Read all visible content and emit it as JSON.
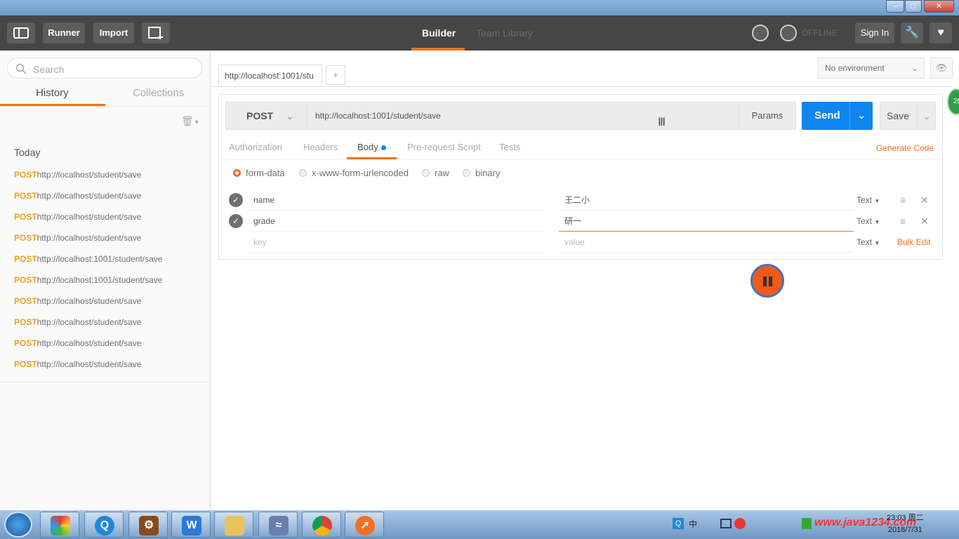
{
  "toolbar": {
    "runner": "Runner",
    "import": "Import",
    "tabs": [
      "Builder",
      "Team Library"
    ],
    "offline": "OFFLINE",
    "signin": "Sign In"
  },
  "sidebar": {
    "search_placeholder": "Search",
    "tabs": [
      "History",
      "Collections"
    ],
    "group_label": "Today",
    "history": [
      {
        "method": "POST",
        "url": "http://localhost/student/save"
      },
      {
        "method": "POST",
        "url": "http://localhost/student/save"
      },
      {
        "method": "POST",
        "url": "http://localhost/student/save"
      },
      {
        "method": "POST",
        "url": "http://localhost/student/save"
      },
      {
        "method": "POST",
        "url": "http://localhost:1001/student/save"
      },
      {
        "method": "POST",
        "url": "http://localhost:1001/student/save"
      },
      {
        "method": "POST",
        "url": "http://localhost/student/save"
      },
      {
        "method": "POST",
        "url": "http://localhost/student/save"
      },
      {
        "method": "POST",
        "url": "http://localhost/student/save"
      },
      {
        "method": "POST",
        "url": "http://localhost/student/save"
      }
    ]
  },
  "main": {
    "request_tab": "http://localhost:1001/stu",
    "add_tab": "+",
    "environment": "No environment",
    "method": "POST",
    "url": "http://localhost:1001/student/save",
    "params": "Params",
    "send": "Send",
    "save": "Save",
    "subtabs": [
      "Authorization",
      "Headers",
      "Body",
      "Pre-request Script",
      "Tests"
    ],
    "generate_code": "Generate Code",
    "body_modes": [
      "form-data",
      "x-www-form-urlencoded",
      "raw",
      "binary"
    ],
    "selected_body_mode": "form-data",
    "form_rows": [
      {
        "key": "name",
        "value": "王二小",
        "type": "Text"
      },
      {
        "key": "grade",
        "value": "研一",
        "type": "Text"
      }
    ],
    "new_row": {
      "key_placeholder": "key",
      "value_placeholder": "value",
      "type": "Text"
    },
    "bulk_edit": "Bulk Edit"
  },
  "overlay": {
    "badge": "28"
  },
  "taskbar": {
    "tray_ime": "中",
    "watermark": "www.java1234.com",
    "time": "23:03 周二",
    "date": "2018/7/31"
  },
  "colors": {
    "accent": "#f47023",
    "send_blue": "#0f86f0",
    "toolbar_bg": "#464646",
    "method_color": "#f0a020"
  }
}
